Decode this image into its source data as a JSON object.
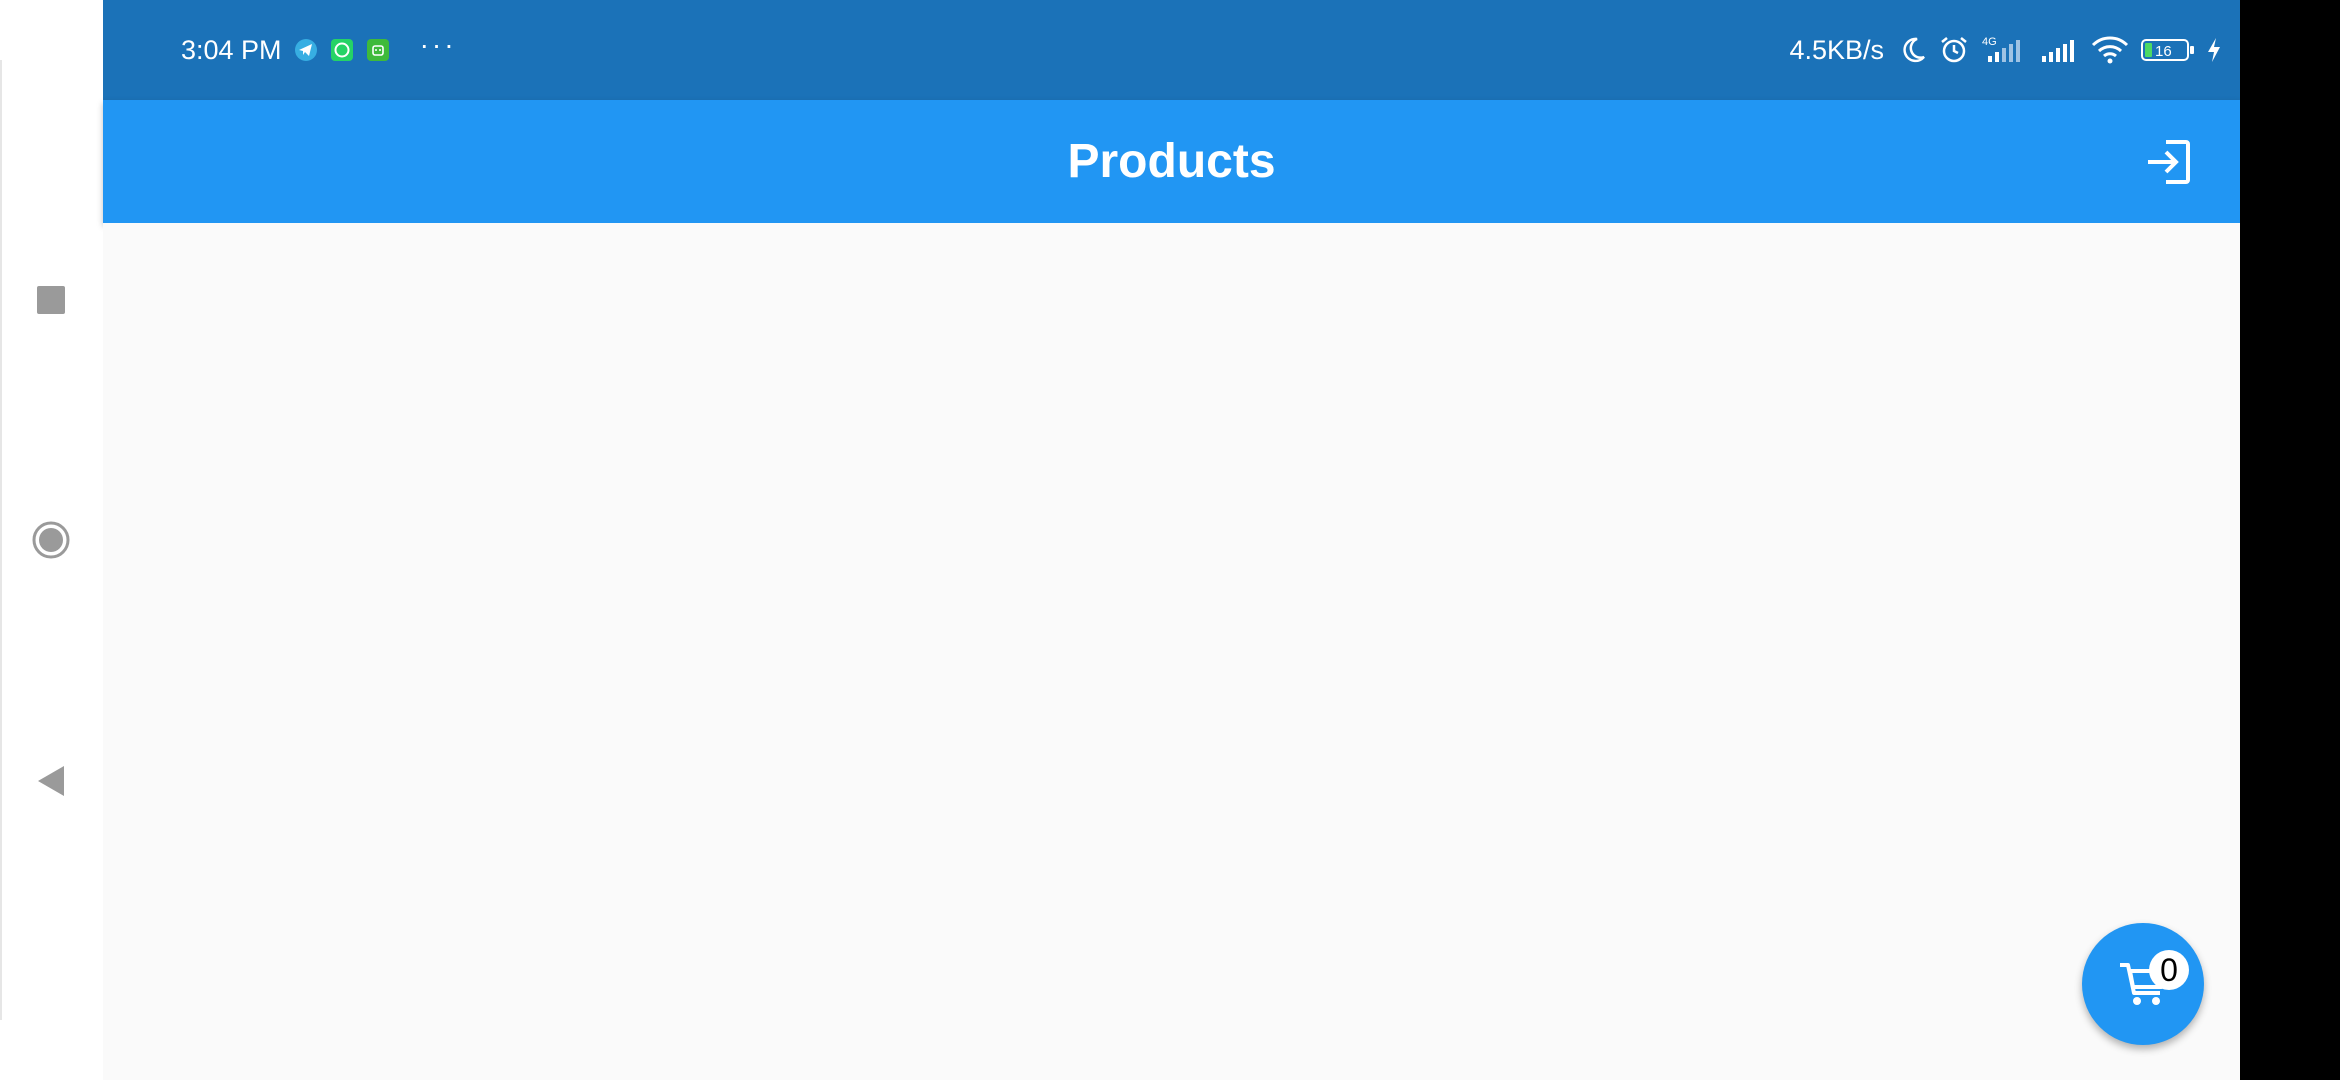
{
  "status_bar": {
    "time": "3:04 PM",
    "network_speed": "4.5KB/s",
    "network_type": "4G",
    "battery_level": "16",
    "notification_icons": [
      "telegram-icon",
      "whatsapp-icon",
      "android-icon"
    ],
    "overflow": "···",
    "status_icons": [
      "moon-icon",
      "alarm-icon",
      "signal-4g-icon",
      "signal-icon",
      "wifi-icon",
      "battery-icon",
      "charging-icon"
    ]
  },
  "app_bar": {
    "title": "Products",
    "action_icon": "login-icon"
  },
  "cart": {
    "count": "0",
    "icon": "shopping-cart-icon"
  },
  "system_nav": {
    "buttons": [
      "recents-icon",
      "home-icon",
      "back-icon"
    ]
  },
  "colors": {
    "status_bar": "#1b72b8",
    "app_bar": "#2196f3",
    "background": "#fafafa",
    "fab": "#2196f3"
  }
}
